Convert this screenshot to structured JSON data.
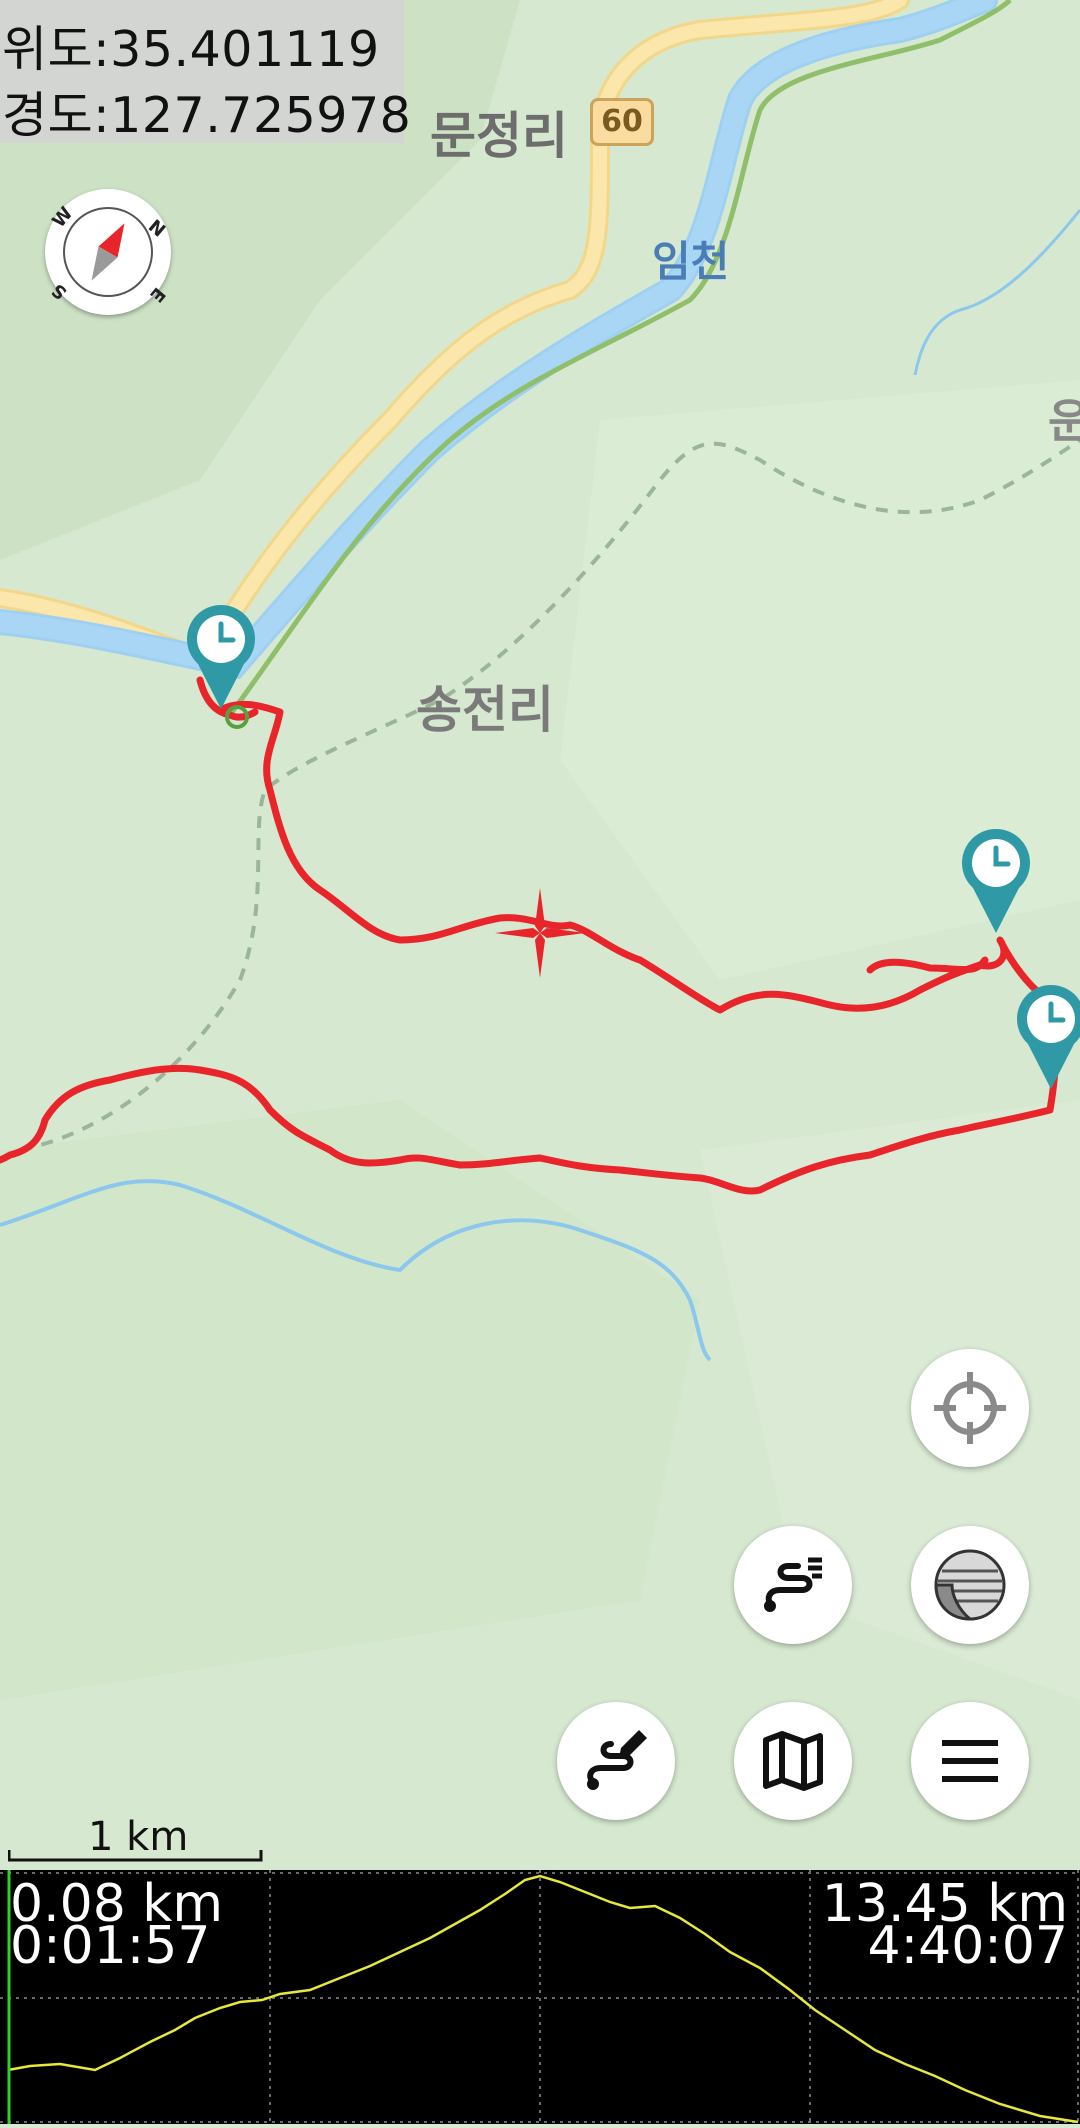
{
  "coords": {
    "lat_label": "위도:35.401119",
    "lon_label": "경도:127.725978"
  },
  "map": {
    "places": {
      "village_north": "문정리",
      "route_badge": "60",
      "river_name": "임천",
      "village_center": "송전리",
      "edge_label": "운"
    },
    "colors": {
      "track": "#e8252b",
      "river": "#a9d6f5",
      "road": "#fbe4a2",
      "marker": "#2f9aa6",
      "terrain": "#d9ead3"
    }
  },
  "compass": {
    "icon": "compass-icon",
    "letters": {
      "n": "N",
      "e": "E",
      "s": "S",
      "w": "W"
    }
  },
  "buttons": {
    "locate": "crosshair-icon",
    "route_list": "route-list-icon",
    "layers": "map-layers-icon",
    "draw_route": "draw-route-icon",
    "map": "map-icon",
    "menu": "menu-icon"
  },
  "scale": {
    "label": "1 km"
  },
  "profile": {
    "start_distance": "0.08 km",
    "start_time": "0:01:57",
    "end_distance": "13.45 km",
    "end_time": "4:40:07",
    "line_color": "#e8e83a",
    "cursor_color": "#2bd42b"
  }
}
